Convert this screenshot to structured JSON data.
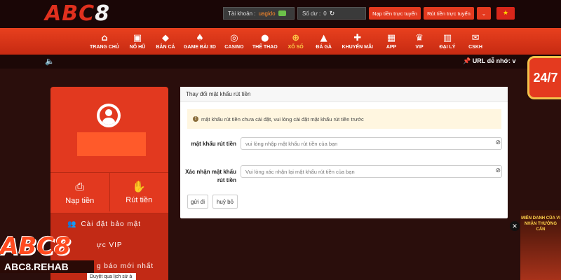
{
  "brand": {
    "logo_text": "ABC",
    "logo_number": "8"
  },
  "header": {
    "account_label": "Tài khoản :",
    "account_value": "uagido",
    "balance_label": "Số dư :",
    "balance_value": "0",
    "deposit_button": "Nạp tiền trực tuyến",
    "withdraw_button": "Rút tiền trực tuyến"
  },
  "nav": {
    "items": [
      {
        "label": "TRANG CHỦ",
        "icon": "⌂"
      },
      {
        "label": "NỔ HŨ",
        "icon": "▣"
      },
      {
        "label": "BẮN CÁ",
        "icon": "◆"
      },
      {
        "label": "GAME BÀI 3D",
        "icon": "♠"
      },
      {
        "label": "CASINO",
        "icon": "◎"
      },
      {
        "label": "THỂ THAO",
        "icon": "●"
      },
      {
        "label": "XỔ SỐ",
        "icon": "⊕"
      },
      {
        "label": "ĐÁ GÀ",
        "icon": "▲"
      },
      {
        "label": "KHUYẾN MÃI",
        "icon": "✚"
      },
      {
        "label": "APP",
        "icon": "▦"
      },
      {
        "label": "VIP",
        "icon": "♛"
      },
      {
        "label": "ĐẠI LÝ",
        "icon": "▥"
      },
      {
        "label": "CSKH",
        "icon": "✉"
      }
    ]
  },
  "marquee": {
    "url_note": "URL dễ nhớ: v"
  },
  "support_badge": "24/7",
  "sidebar": {
    "deposit": "Nạp tiền",
    "withdraw": "Rút tiền",
    "menu": [
      {
        "label": "Cài đặt bảo mật"
      },
      {
        "label": "ực VIP"
      },
      {
        "label": "g báo mới nhất"
      }
    ]
  },
  "form": {
    "title": "Thay đổi mật khẩu rút tiền",
    "warning": "mật khẩu rút tiền chưa cài đặt, vui lòng cài đặt mật khẩu rút tiền trước",
    "password_label": "mật khẩu rút tiền",
    "password_placeholder": "vui lòng nhập mật khẩu rút tiền của bạn",
    "confirm_label": "Xác nhận mật khẩu rút tiền",
    "confirm_placeholder": "Vui lòng xác nhận lại mật khẩu rút tiền của bạn",
    "submit": "gửi đi",
    "cancel": "huỷ bỏ"
  },
  "watermark": {
    "logo": "ABC8",
    "site": "ABC8.REHAB"
  },
  "history_tab": "Duyệt qua lịch sử ả",
  "promo": {
    "line1": "MIỄN DANH CỦA VI",
    "line2": "NHẬN THƯỞNG CẤN"
  },
  "colors": {
    "brand_red": "#e2391f",
    "header_bg": "#1a0606",
    "accent_orange": "#ff8a2a",
    "active_gold": "#ffd24a"
  }
}
